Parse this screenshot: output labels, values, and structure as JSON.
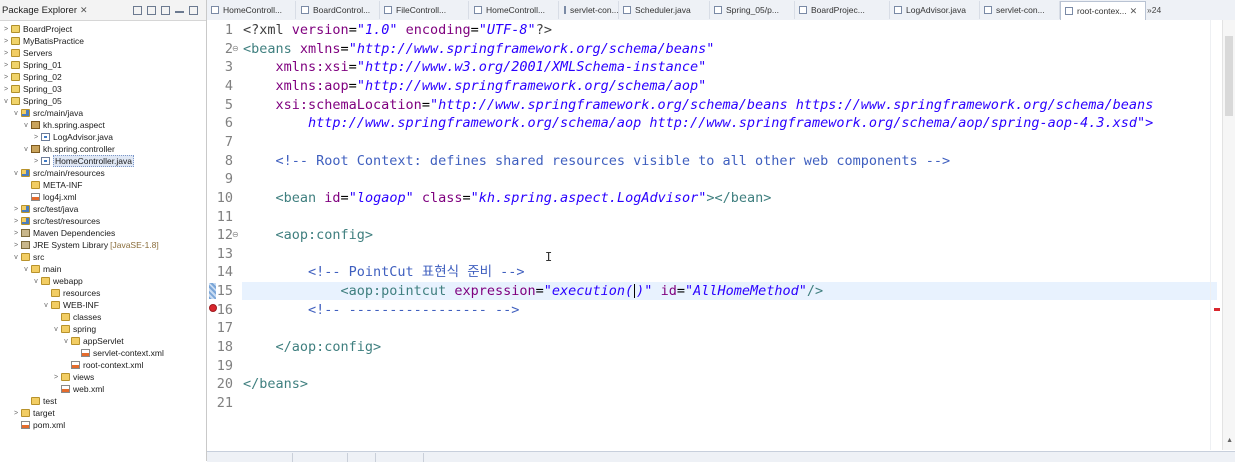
{
  "package_explorer": {
    "title": "Package Explorer",
    "close_glyph": "✕",
    "tree": [
      {
        "label": "BoardProject",
        "icon": "project-icon",
        "level": 0,
        "twisty": ">"
      },
      {
        "label": "MyBatisPractice",
        "icon": "project-icon",
        "level": 0,
        "twisty": ">"
      },
      {
        "label": "Servers",
        "icon": "folder-icon",
        "level": 0,
        "twisty": ">"
      },
      {
        "label": "Spring_01",
        "icon": "project-icon",
        "level": 0,
        "twisty": ">"
      },
      {
        "label": "Spring_02",
        "icon": "project-icon",
        "level": 0,
        "twisty": ">"
      },
      {
        "label": "Spring_03",
        "icon": "project-icon",
        "level": 0,
        "twisty": ">"
      },
      {
        "label": "Spring_05",
        "icon": "project-icon",
        "level": 0,
        "twisty": "v"
      },
      {
        "label": "src/main/java",
        "icon": "source-folder-icon",
        "level": 1,
        "twisty": "v"
      },
      {
        "label": "kh.spring.aspect",
        "icon": "package-icon",
        "level": 2,
        "twisty": "v"
      },
      {
        "label": "LogAdvisor.java",
        "icon": "java-file-icon",
        "level": 3,
        "twisty": ">"
      },
      {
        "label": "kh.spring.controller",
        "icon": "package-icon",
        "level": 2,
        "twisty": "v"
      },
      {
        "label": "HomeController.java",
        "icon": "java-file-icon",
        "level": 3,
        "twisty": ">",
        "selected": true
      },
      {
        "label": "src/main/resources",
        "icon": "source-folder-icon",
        "level": 1,
        "twisty": "v"
      },
      {
        "label": "META-INF",
        "icon": "folder-icon",
        "level": 2,
        "twisty": ""
      },
      {
        "label": "log4j.xml",
        "icon": "xml-file-icon",
        "level": 2,
        "twisty": ""
      },
      {
        "label": "src/test/java",
        "icon": "source-folder-icon",
        "level": 1,
        "twisty": ">"
      },
      {
        "label": "src/test/resources",
        "icon": "source-folder-icon",
        "level": 1,
        "twisty": ">"
      },
      {
        "label": "Maven Dependencies",
        "icon": "library-icon",
        "level": 1,
        "twisty": ">"
      },
      {
        "label": "JRE System Library",
        "decoration": "[JavaSE-1.8]",
        "icon": "library-icon",
        "level": 1,
        "twisty": ">"
      },
      {
        "label": "src",
        "icon": "folder-icon",
        "level": 1,
        "twisty": "v"
      },
      {
        "label": "main",
        "icon": "folder-icon",
        "level": 2,
        "twisty": "v"
      },
      {
        "label": "webapp",
        "icon": "folder-icon",
        "level": 3,
        "twisty": "v"
      },
      {
        "label": "resources",
        "icon": "folder-icon",
        "level": 4,
        "twisty": ""
      },
      {
        "label": "WEB-INF",
        "icon": "folder-icon",
        "level": 4,
        "twisty": "v"
      },
      {
        "label": "classes",
        "icon": "folder-icon",
        "level": 5,
        "twisty": ""
      },
      {
        "label": "spring",
        "icon": "folder-icon",
        "level": 5,
        "twisty": "v"
      },
      {
        "label": "appServlet",
        "icon": "folder-icon",
        "level": 6,
        "twisty": "v"
      },
      {
        "label": "servlet-context.xml",
        "icon": "xml-file-icon",
        "level": 7,
        "twisty": ""
      },
      {
        "label": "root-context.xml",
        "icon": "xml-file-icon",
        "level": 6,
        "twisty": ""
      },
      {
        "label": "views",
        "icon": "folder-icon",
        "level": 5,
        "twisty": ">"
      },
      {
        "label": "web.xml",
        "icon": "xml-file-icon",
        "level": 5,
        "twisty": ""
      },
      {
        "label": "test",
        "icon": "folder-icon",
        "level": 2,
        "twisty": ""
      },
      {
        "label": "target",
        "icon": "folder-icon",
        "level": 1,
        "twisty": ">"
      },
      {
        "label": "pom.xml",
        "icon": "xml-file-icon",
        "level": 1,
        "twisty": ""
      }
    ]
  },
  "editor_tabs": [
    {
      "label": "HomeControll..."
    },
    {
      "label": "BoardControl..."
    },
    {
      "label": "FileControll..."
    },
    {
      "label": "HomeControll..."
    },
    {
      "label": "servlet-con..."
    },
    {
      "label": "Scheduler.java"
    },
    {
      "label": "Spring_05/p..."
    },
    {
      "label": "BoardProjec..."
    },
    {
      "label": "LogAdvisor.java"
    },
    {
      "label": "servlet-con..."
    },
    {
      "label": "root-contex...",
      "active": true,
      "close": "✕"
    },
    {
      "label": "»24",
      "overflow": true
    }
  ],
  "editor": {
    "current_line": 15,
    "error_line": 16,
    "lines": [
      {
        "n": "1",
        "parts": [
          {
            "t": "<?xml ",
            "c": "pi"
          },
          {
            "t": "version",
            "c": "attr"
          },
          {
            "t": "=",
            "c": "plain"
          },
          {
            "t": "\"1.0\"",
            "c": "val"
          },
          {
            "t": " ",
            "c": "plain"
          },
          {
            "t": "encoding",
            "c": "attr"
          },
          {
            "t": "=",
            "c": "plain"
          },
          {
            "t": "\"UTF-8\"",
            "c": "val"
          },
          {
            "t": "?>",
            "c": "pi"
          }
        ]
      },
      {
        "n": "2",
        "fold": true,
        "parts": [
          {
            "t": "<beans ",
            "c": "tag"
          },
          {
            "t": "xmlns",
            "c": "attr"
          },
          {
            "t": "=",
            "c": "plain"
          },
          {
            "t": "\"http://www.springframework.org/schema/beans\"",
            "c": "val"
          }
        ]
      },
      {
        "n": "3",
        "parts": [
          {
            "t": "    xmlns:xsi",
            "c": "attr"
          },
          {
            "t": "=",
            "c": "plain"
          },
          {
            "t": "\"http://www.w3.org/2001/XMLSchema-instance\"",
            "c": "val"
          }
        ]
      },
      {
        "n": "4",
        "parts": [
          {
            "t": "    xmlns:aop",
            "c": "attr"
          },
          {
            "t": "=",
            "c": "plain"
          },
          {
            "t": "\"http://www.springframework.org/schema/aop\"",
            "c": "val"
          }
        ]
      },
      {
        "n": "5",
        "parts": [
          {
            "t": "    xsi:schemaLocation",
            "c": "attr"
          },
          {
            "t": "=",
            "c": "plain"
          },
          {
            "t": "\"http://www.springframework.org/schema/beans https://www.springframework.org/schema/beans",
            "c": "val"
          }
        ]
      },
      {
        "n": "6",
        "parts": [
          {
            "t": "        http://www.springframework.org/schema/aop http://www.springframework.org/schema/aop/spring-aop-4.3.xsd\">",
            "c": "val"
          }
        ]
      },
      {
        "n": "7",
        "parts": []
      },
      {
        "n": "8",
        "parts": [
          {
            "t": "    <!-- Root Context: defines shared resources visible to all other web components -->",
            "c": "cmt"
          }
        ]
      },
      {
        "n": "9",
        "parts": []
      },
      {
        "n": "10",
        "parts": [
          {
            "t": "    <bean ",
            "c": "tag"
          },
          {
            "t": "id",
            "c": "attr"
          },
          {
            "t": "=",
            "c": "plain"
          },
          {
            "t": "\"logaop\"",
            "c": "val"
          },
          {
            "t": " ",
            "c": "plain"
          },
          {
            "t": "class",
            "c": "attr"
          },
          {
            "t": "=",
            "c": "plain"
          },
          {
            "t": "\"kh.spring.aspect.LogAdvisor\"",
            "c": "val"
          },
          {
            "t": "></bean>",
            "c": "tag"
          }
        ]
      },
      {
        "n": "11",
        "parts": []
      },
      {
        "n": "12",
        "fold": true,
        "parts": [
          {
            "t": "    <aop:config>",
            "c": "tag"
          }
        ]
      },
      {
        "n": "13",
        "parts": []
      },
      {
        "n": "14",
        "parts": [
          {
            "t": "        <!-- PointCut 표현식 준비 -->",
            "c": "cmt"
          }
        ]
      },
      {
        "n": "15",
        "parts": [
          {
            "t": "            <aop:pointcut ",
            "c": "tag"
          },
          {
            "t": "expression",
            "c": "attr"
          },
          {
            "t": "=",
            "c": "plain"
          },
          {
            "t": "\"execution(",
            "c": "val"
          },
          {
            "t": "",
            "c": "caret"
          },
          {
            "t": ")\"",
            "c": "val"
          },
          {
            "t": " ",
            "c": "plain"
          },
          {
            "t": "id",
            "c": "attr"
          },
          {
            "t": "=",
            "c": "plain"
          },
          {
            "t": "\"AllHomeMethod\"",
            "c": "val"
          },
          {
            "t": "/>",
            "c": "tag"
          }
        ]
      },
      {
        "n": "16",
        "parts": [
          {
            "t": "        <!-- ----------------- -->",
            "c": "cmt"
          }
        ]
      },
      {
        "n": "17",
        "parts": []
      },
      {
        "n": "18",
        "parts": [
          {
            "t": "    </aop:config>",
            "c": "tag"
          }
        ]
      },
      {
        "n": "19",
        "parts": []
      },
      {
        "n": "20",
        "parts": [
          {
            "t": "</beans>",
            "c": "tag"
          }
        ]
      },
      {
        "n": "21",
        "parts": []
      }
    ]
  },
  "colors": {
    "tag": "#3f7f7f",
    "attr": "#7f007f",
    "value": "#2a00ff",
    "comment": "#3f5fbf",
    "current_line": "#e8f2fe",
    "error": "#d9272e"
  }
}
